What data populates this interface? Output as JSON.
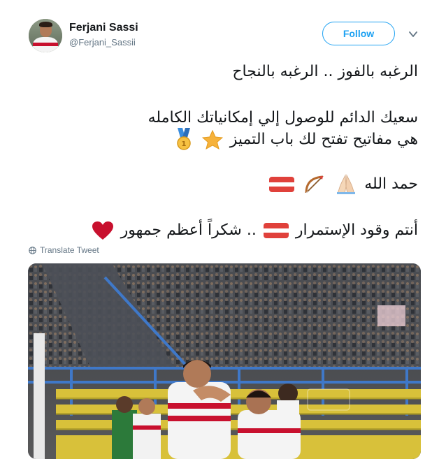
{
  "user": {
    "name": "Ferjani Sassi",
    "handle": "@Ferjani_Sassii"
  },
  "follow_label": "Follow",
  "tweet": {
    "line1": "الرغبه بالفوز  .. الرغبه بالنجاح",
    "line2": "سعيك الدائم للوصول إلي إمكانياتك الكامله",
    "line3": "هي مفاتيح تفتح لك باب التميز",
    "line4": "حمد الله",
    "line5_part1": "أنتم وقود الإستمرار",
    "line5_part2": ".. شكراً أعظم جمهور"
  },
  "icons": {
    "star": "star-emoji",
    "medal": "medal-emoji",
    "pray": "folded-hands-emoji",
    "bow": "bow-and-arrow-emoji",
    "flag": "flag-emoji",
    "heart": "red-heart-emoji"
  },
  "colors": {
    "accent": "#1da1f2",
    "flag_red": "#e0413b",
    "heart_red": "#c8102e"
  },
  "translate_label": "Translate Tweet"
}
